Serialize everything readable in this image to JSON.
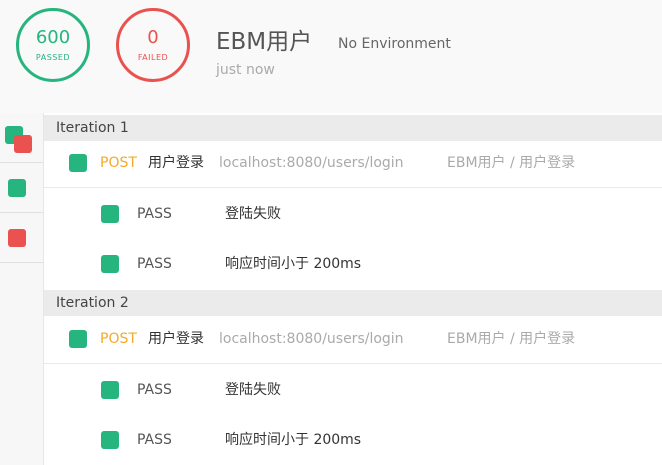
{
  "summary": {
    "passed_count": "600",
    "passed_label": "PASSED",
    "failed_count": "0",
    "failed_label": "FAILED"
  },
  "header": {
    "title": "EBM用户",
    "environment": "No Environment",
    "time": "just now"
  },
  "colors": {
    "pass": "#26b47f",
    "fail": "#e9524f",
    "method": "#f4a92a"
  },
  "iterations": [
    {
      "label": "Iteration 1",
      "request": {
        "method": "POST",
        "name": "用户登录",
        "url": "localhost:8080/users/login",
        "path": "EBM用户 / 用户登录"
      },
      "tests": [
        {
          "status": "PASS",
          "name": "登陆失败"
        },
        {
          "status": "PASS",
          "name": "响应时间小于 200ms"
        }
      ]
    },
    {
      "label": "Iteration 2",
      "request": {
        "method": "POST",
        "name": "用户登录",
        "url": "localhost:8080/users/login",
        "path": "EBM用户 / 用户登录"
      },
      "tests": [
        {
          "status": "PASS",
          "name": "登陆失败"
        },
        {
          "status": "PASS",
          "name": "响应时间小于 200ms"
        }
      ]
    }
  ]
}
